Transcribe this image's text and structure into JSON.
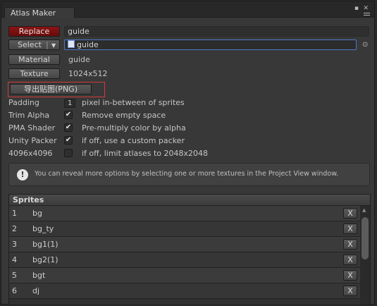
{
  "window": {
    "tab_title": "Atlas Maker",
    "maximize_glyph": "▪",
    "close_glyph": "✕"
  },
  "replace": {
    "button_label": "Replace",
    "value": "guide"
  },
  "select": {
    "button_label": "Select",
    "value": "guide",
    "picker_glyph": "⊙"
  },
  "material": {
    "button_label": "Material",
    "value": "guide"
  },
  "texture": {
    "button_label": "Texture",
    "value": "1024x512"
  },
  "export": {
    "button_label": "导出贴图(PNG)"
  },
  "settings": {
    "padding": {
      "label": "Padding",
      "value": "1",
      "description": "pixel in-between of sprites"
    },
    "trim_alpha": {
      "label": "Trim Alpha",
      "checked": true,
      "description": "Remove empty space"
    },
    "pma_shader": {
      "label": "PMA Shader",
      "checked": true,
      "description": "Pre-multiply color by alpha"
    },
    "unity_packer": {
      "label": "Unity Packer",
      "checked": true,
      "description": "if off, use a custom packer"
    },
    "size_4096": {
      "label": "4096x4096",
      "checked": false,
      "description": "if off, limit atlases to 2048x2048"
    }
  },
  "help": {
    "icon_glyph": "!",
    "text": "You can reveal more options by selecting one or more textures in the Project View window."
  },
  "sprites": {
    "header": "Sprites",
    "remove_label": "X",
    "items": [
      {
        "index": "1",
        "name": "bg"
      },
      {
        "index": "2",
        "name": "bg_ty"
      },
      {
        "index": "3",
        "name": "bg1(1)"
      },
      {
        "index": "4",
        "name": "bg2(1)"
      },
      {
        "index": "5",
        "name": "bgt"
      },
      {
        "index": "6",
        "name": "dj"
      }
    ]
  },
  "colors": {
    "replace_button": "#7a0f0f",
    "focus_border": "#4e78c8",
    "highlight_border": "#d23a3a"
  }
}
